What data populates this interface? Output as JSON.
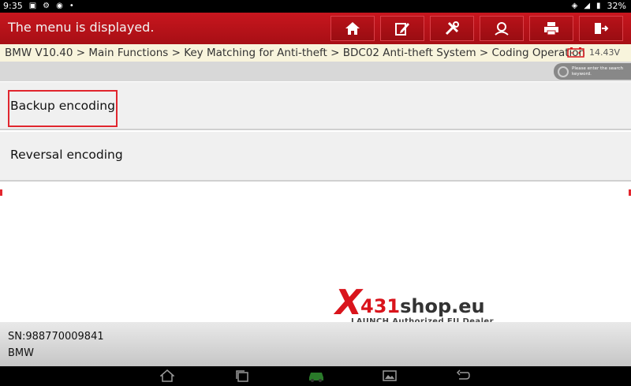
{
  "status_bar": {
    "time": "9:35",
    "battery": "32%",
    "left_icons": [
      "image-icon",
      "settings-icon",
      "wifi-icon",
      "dot-icon"
    ],
    "right_icons": [
      "location-icon",
      "signal-icon",
      "battery-icon"
    ]
  },
  "header": {
    "title": "The menu is displayed.",
    "buttons": [
      {
        "name": "home-button",
        "icon": "home-icon"
      },
      {
        "name": "report-button",
        "icon": "edit-icon"
      },
      {
        "name": "tools-button",
        "icon": "tools-icon"
      },
      {
        "name": "user-button",
        "icon": "user-icon"
      },
      {
        "name": "print-button",
        "icon": "printer-icon"
      },
      {
        "name": "exit-button",
        "icon": "exit-icon"
      }
    ],
    "color": "#c8161e"
  },
  "breadcrumb": {
    "path": "BMW V10.40 > Main Functions > Key Matching for Anti-theft > BDC02 Anti-theft System > Coding Operation",
    "voltage": "14.43V"
  },
  "search": {
    "placeholder": "Please enter the search keyword."
  },
  "menu": {
    "items": [
      {
        "label": "Backup encoding",
        "selected": true
      },
      {
        "label": "Reversal encoding",
        "selected": false
      }
    ],
    "selection_color": "#e0262e"
  },
  "watermark": {
    "logo_x": "X",
    "logo_num": "431",
    "logo_rest": "shop.eu",
    "tagline": "LAUNCH Authorized EU Dealer"
  },
  "footer": {
    "sn": "SN:988770009841",
    "make": "BMW"
  },
  "nav_bar": {
    "icons": [
      "home-icon",
      "recents-icon",
      "car-icon",
      "gallery-icon",
      "back-icon"
    ]
  }
}
